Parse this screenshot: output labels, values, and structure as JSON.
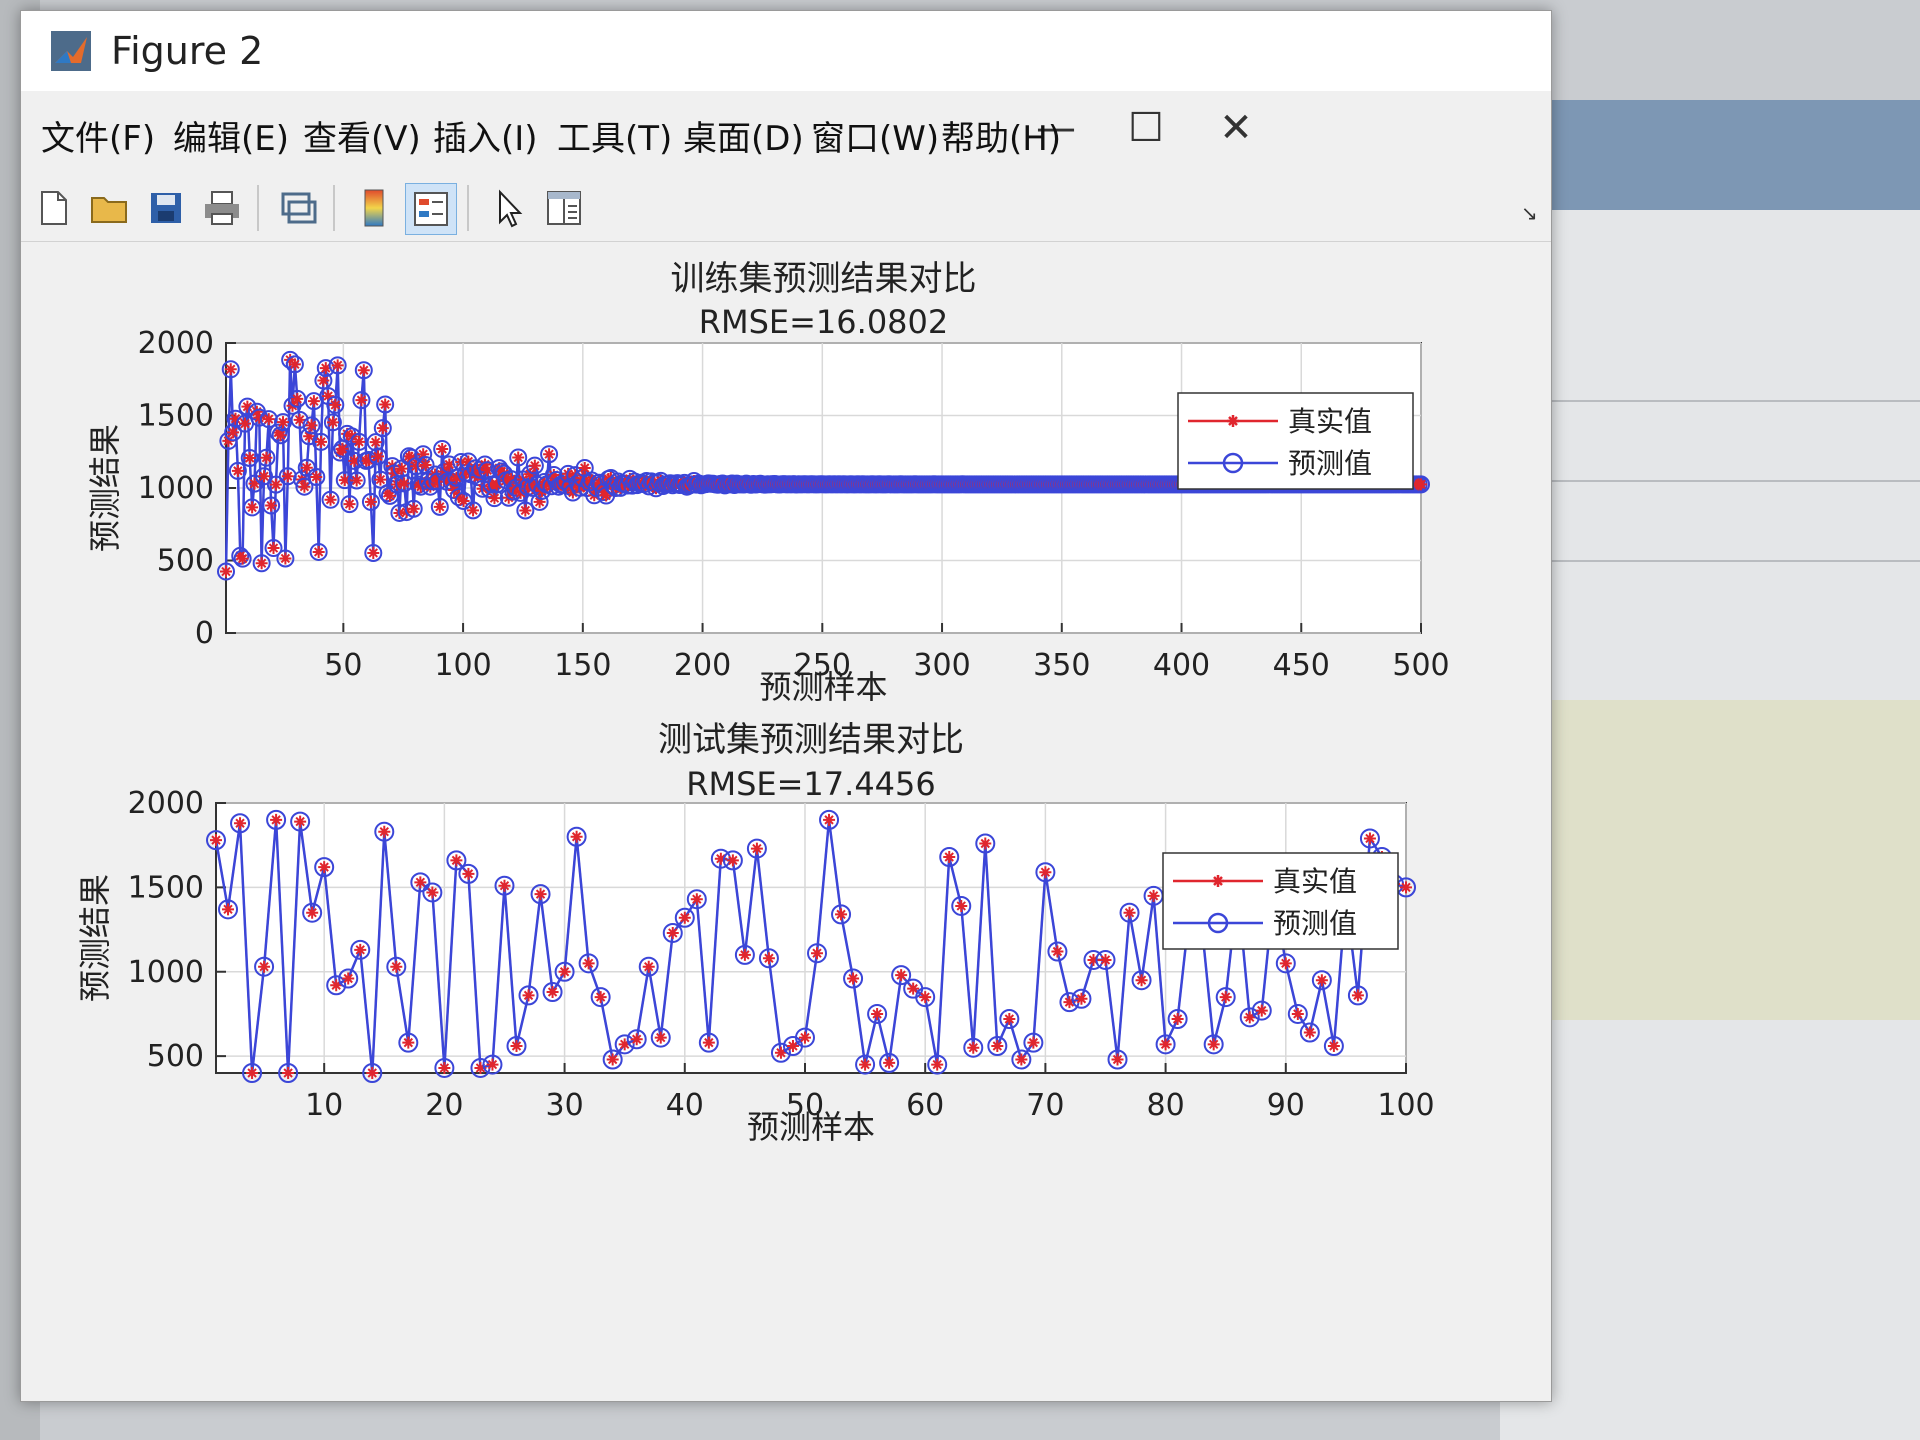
{
  "window": {
    "title": "Figure 2",
    "controls": {
      "minimize": "—",
      "maximize": "☐",
      "close": "✕"
    }
  },
  "menu": [
    {
      "label": "文件(F)"
    },
    {
      "label": "编辑(E)"
    },
    {
      "label": "查看(V)"
    },
    {
      "label": "插入(I)"
    },
    {
      "label": "工具(T)"
    },
    {
      "label": "桌面(D)"
    },
    {
      "label": "窗口(W)"
    },
    {
      "label": "帮助(H)"
    }
  ],
  "toolbar": [
    {
      "icon": "new-file-icon"
    },
    {
      "icon": "open-folder-icon"
    },
    {
      "icon": "save-icon"
    },
    {
      "icon": "print-icon"
    },
    {
      "icon": "link-plot-icon"
    },
    {
      "icon": "colorbar-icon"
    },
    {
      "icon": "legend-icon",
      "active": true
    },
    {
      "icon": "pointer-icon"
    },
    {
      "icon": "property-editor-icon"
    }
  ],
  "colors": {
    "true_series": "#e0262e",
    "pred_series": "#3b46d8",
    "grid": "#d9d9d9"
  },
  "chart_data": [
    {
      "type": "line",
      "title": "训练集预测结果对比",
      "subtitle": "RMSE=16.0802",
      "xlabel": "预测样本",
      "ylabel": "预测结果",
      "xlim": [
        1,
        500
      ],
      "ylim": [
        0,
        2000
      ],
      "xticks": [
        50,
        100,
        150,
        200,
        250,
        300,
        350,
        400,
        450,
        500
      ],
      "yticks": [
        0,
        500,
        1000,
        1500,
        2000
      ],
      "grid": true,
      "legend_position": "top-right",
      "series": [
        {
          "name": "真实值",
          "marker": "*",
          "color": "#e0262e",
          "y": [
            424,
            1325,
            1819,
            1384,
            1478,
            1118,
            532,
            513,
            1444,
            1561,
            1207,
            866,
            1030,
            1526,
            1485,
            481,
            1081,
            1209,
            1475,
            879,
            586,
            1023,
            1382,
            1364,
            1454,
            514,
            1081,
            1884,
            1567,
            1853,
            1615,
            1470,
            1059,
            1009,
            1140,
            1357,
            1432,
            1599,
            1076,
            559,
            1318,
            1741,
            1827,
            1634,
            919,
            1453,
            1573,
            1846,
            1245,
            1271,
            1054,
            1373,
            889,
            1356,
            1187,
            1052,
            1318,
            1606,
            1812,
            1187,
            1193,
            904,
            552,
            1316,
            1218,
            1058,
            1413,
            1576,
            965,
            946,
            1151,
            1101,
            1024,
            828,
            1134,
            1032,
            834,
            1219,
            1209,
            857,
            1150,
            1023,
            1009,
            1233,
            1159,
            1047,
            1009,
            1046,
            1093,
            1044,
            870,
            1269,
            1113,
            1043,
            1162,
            1044,
            986,
            1071,
            937,
            1179,
            910,
            1105,
            1183,
            1095,
            846,
            1136,
            1075,
            1126,
            995,
            1162,
            1122,
            992,
            1024,
            930,
            1025,
            1137,
            1114,
            1098,
            1053,
            933,
            1061,
            975,
            1002,
            1210,
            966,
            1059,
            845,
            1007,
            1096,
            1001,
            1154,
            1023,
            904,
            980,
            1041,
            1025,
            1233,
            1012,
            1090,
            1055,
            1009,
            1023,
            1025,
            1046,
            1097,
            1009,
            969,
            1089,
            1031,
            1002,
            1068,
            1138,
            1000,
            1037,
            1052,
            950,
            999,
            1036,
            1025,
            972,
            948,
            1062,
            1069,
            1016,
            1000,
            1045,
            1001,
            1031,
            1030,
            1017,
            1063,
            1016,
            1045,
            1020,
            1032,
            1036,
            1027,
            1048,
            1011,
            1046,
            1034,
            998,
            1036,
            1049,
            1014,
            1024,
            1028,
            1033,
            1019,
            1030,
            1034,
            1021,
            1023,
            1035,
            1009,
            1017,
            1025,
            1048,
            1023,
            1031,
            1019,
            1025,
            1027,
            1032,
            1029,
            1029,
            1025,
            1022,
            1028,
            1031,
            1018,
            1026,
            1025,
            1031,
            1021,
            1030,
            1025,
            1025,
            1024,
            1030,
            1026,
            1022,
            1028,
            1024,
            1027,
            1029,
            1025,
            1023,
            1026,
            1025,
            1027,
            1028,
            1025,
            1024,
            1026,
            1027,
            1025,
            1026,
            1025,
            1027,
            1024,
            1026,
            1025,
            1026,
            1026,
            1025,
            1026,
            1026,
            1025,
            1025,
            1026,
            1026,
            1025,
            1025,
            1026,
            1025,
            1026,
            1025,
            1026,
            1025,
            1026,
            1025,
            1025,
            1026,
            1025,
            1025,
            1026,
            1025,
            1026,
            1025,
            1025,
            1025,
            1026,
            1025,
            1025,
            1026,
            1025,
            1025,
            1025,
            1026,
            1025,
            1025,
            1025,
            1025,
            1026,
            1025,
            1025,
            1025,
            1025,
            1025,
            1026,
            1025,
            1025,
            1025,
            1025,
            1025,
            1025,
            1025,
            1026,
            1025,
            1025,
            1025,
            1025,
            1025,
            1025,
            1025,
            1025,
            1025,
            1025,
            1025,
            1026,
            1025,
            1025,
            1025,
            1025,
            1025,
            1025,
            1025,
            1025,
            1025,
            1025,
            1025,
            1025,
            1025,
            1025,
            1025,
            1025,
            1025,
            1025,
            1025,
            1025,
            1025,
            1025,
            1025,
            1025,
            1025,
            1025,
            1025,
            1025,
            1025,
            1025,
            1025,
            1025,
            1025,
            1025,
            1025,
            1025,
            1025,
            1025,
            1025,
            1025,
            1025,
            1025,
            1025,
            1025,
            1025,
            1025,
            1025,
            1025,
            1025,
            1025,
            1025,
            1025,
            1025,
            1025,
            1025,
            1025,
            1025,
            1025,
            1025,
            1025,
            1025,
            1025,
            1025,
            1025,
            1025,
            1025,
            1025,
            1025,
            1025,
            1025,
            1025,
            1025,
            1025,
            1025,
            1025,
            1025,
            1025,
            1025,
            1025,
            1025,
            1025,
            1025,
            1025,
            1025,
            1025,
            1025,
            1025,
            1025,
            1025,
            1025,
            1025,
            1025,
            1025,
            1025,
            1025,
            1025,
            1025,
            1025,
            1025,
            1025,
            1025,
            1025,
            1025,
            1025,
            1025,
            1025,
            1025,
            1025,
            1025,
            1025,
            1025,
            1025,
            1025,
            1025,
            1025,
            1025,
            1025,
            1025,
            1025,
            1025,
            1025,
            1025,
            1025,
            1025,
            1025,
            1025,
            1025,
            1025,
            1025,
            1025,
            1025,
            1025,
            1025,
            1025,
            1025,
            1025,
            1025,
            1025,
            1025,
            1025,
            1025,
            1025,
            1025,
            1025,
            1025,
            1025,
            1025,
            1025,
            1025,
            1025,
            1025,
            1025,
            1025,
            1025,
            1025,
            1025,
            1025,
            1025,
            1025,
            1025,
            1025,
            1025,
            1025,
            1025,
            1025,
            1025,
            1025,
            1025,
            1025,
            1025,
            1025,
            1025,
            1025,
            1025,
            1025,
            1025,
            1025,
            1025,
            1025,
            1025,
            1025,
            1025,
            1025,
            1025,
            1025,
            1025,
            1025,
            1025,
            1025,
            1025,
            1025,
            1025,
            1025
          ]
        },
        {
          "name": "预测值",
          "marker": "o",
          "color": "#3b46d8"
        }
      ]
    },
    {
      "type": "line",
      "title": "测试集预测结果对比",
      "subtitle": "RMSE=17.4456",
      "xlabel": "预测样本",
      "ylabel": "预测结果",
      "xlim": [
        1,
        100
      ],
      "ylim": [
        400,
        2000
      ],
      "xticks": [
        10,
        20,
        30,
        40,
        50,
        60,
        70,
        80,
        90,
        100
      ],
      "yticks": [
        500,
        1000,
        1500,
        2000
      ],
      "grid": true,
      "legend_position": "top-right",
      "series": [
        {
          "name": "真实值",
          "marker": "*",
          "color": "#e0262e",
          "y": [
            1780,
            1370,
            1880,
            400,
            1030,
            1900,
            400,
            1890,
            1350,
            1620,
            920,
            960,
            1130,
            400,
            1830,
            1030,
            580,
            1530,
            1470,
            430,
            1660,
            1580,
            430,
            450,
            1510,
            560,
            860,
            1460,
            880,
            1000,
            1800,
            1050,
            850,
            480,
            570,
            600,
            1030,
            610,
            1230,
            1320,
            1430,
            580,
            1670,
            1660,
            1100,
            1730,
            1080,
            520,
            560,
            610,
            1110,
            1900,
            1340,
            960,
            450,
            750,
            460,
            980,
            900,
            850,
            450,
            1680,
            1390,
            550,
            1760,
            560,
            720,
            480,
            580,
            1590,
            1120,
            820,
            840,
            1070,
            1070,
            480,
            1350,
            950,
            1450,
            570,
            720,
            1360,
            1280,
            570,
            850,
            1490,
            730,
            770,
            1470,
            1050,
            750,
            640,
            950,
            560,
            1440,
            860,
            1790,
            1680,
            1520,
            1500
          ]
        },
        {
          "name": "预测值",
          "marker": "o",
          "color": "#3b46d8"
        }
      ]
    }
  ]
}
